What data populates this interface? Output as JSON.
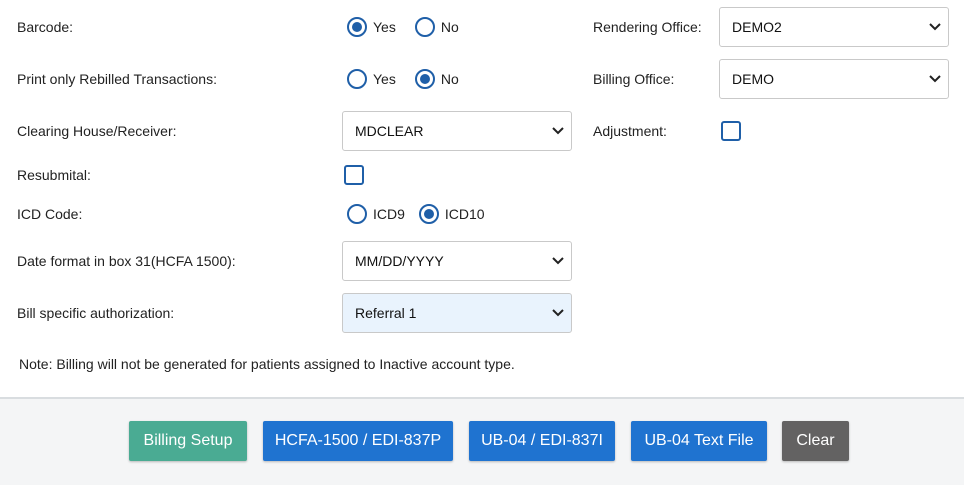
{
  "form": {
    "barcode": {
      "label": "Barcode:",
      "options": [
        "Yes",
        "No"
      ],
      "selected": "Yes"
    },
    "print_rebilled": {
      "label": "Print only Rebilled Transactions:",
      "options": [
        "Yes",
        "No"
      ],
      "selected": "No"
    },
    "clearing_house": {
      "label": "Clearing House/Receiver:",
      "value": "MDCLEAR"
    },
    "resubmittal": {
      "label": "Resubmital:",
      "checked": false
    },
    "icd_code": {
      "label": "ICD Code:",
      "options": [
        "ICD9",
        "ICD10"
      ],
      "selected": "ICD10"
    },
    "date_format": {
      "label": "Date format in box 31(HCFA 1500):",
      "value": "MM/DD/YYYY"
    },
    "bill_auth": {
      "label": "Bill specific authorization:",
      "value": "Referral 1"
    },
    "rendering_office": {
      "label": "Rendering Office:",
      "value": "DEMO2"
    },
    "billing_office": {
      "label": "Billing Office:",
      "value": "DEMO"
    },
    "adjustment": {
      "label": "Adjustment:",
      "checked": false
    }
  },
  "note": "Note: Billing will not be generated for patients assigned to Inactive account type.",
  "buttons": {
    "billing_setup": "Billing Setup",
    "hcfa": "HCFA-1500 / EDI-837P",
    "ub04_edi": "UB-04 / EDI-837I",
    "ub04_text": "UB-04 Text File",
    "clear": "Clear"
  },
  "colors": {
    "accent": "#1f5fa8",
    "green_button": "#4aab93",
    "blue_button": "#1f73d0",
    "gray_button": "#636262"
  }
}
